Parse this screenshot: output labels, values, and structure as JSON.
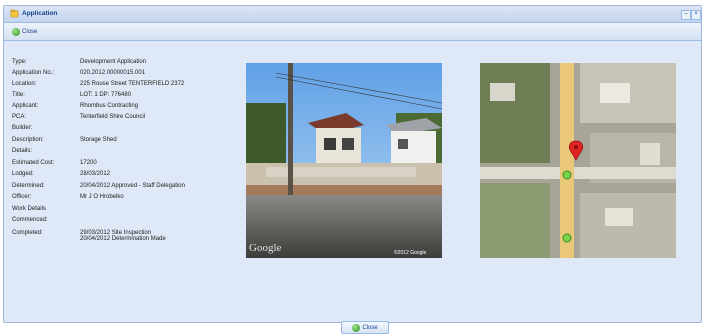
{
  "window": {
    "title": "Application"
  },
  "toolbar": {
    "close_label": "Close"
  },
  "details": [
    {
      "label": "Type:",
      "value": [
        "Development Application"
      ]
    },
    {
      "label": "Application No.:",
      "value": [
        "020.2012.00000015.001"
      ]
    },
    {
      "label": "Location:",
      "value": [
        "225 Rouse Street TENTERFIELD 2372"
      ]
    },
    {
      "label": "Title:",
      "value": [
        "LOT: 1 DP: 776480"
      ]
    },
    {
      "label": "Applicant:",
      "value": [
        "Rhombus Contracting"
      ]
    },
    {
      "label": "PCA:",
      "value": [
        "Tenterfield Shire Council"
      ]
    },
    {
      "label": "Builder:",
      "value": []
    },
    {
      "label": "Description:",
      "value": [
        "Storage Shed"
      ]
    },
    {
      "label": "Details:",
      "value": []
    },
    {
      "label": "Estimated Cost:",
      "value": [
        "17200"
      ]
    },
    {
      "label": "Lodged:",
      "value": [
        "28/03/2012"
      ]
    },
    {
      "label": "Determined:",
      "value": [
        "20/04/2012  Approved - Staff Delegation"
      ]
    },
    {
      "label": "Officer:",
      "value": [
        "Mr J O Hrobelko"
      ]
    },
    {
      "label": "Work Details",
      "value": []
    },
    {
      "label": "Commenced:",
      "value": []
    },
    {
      "label": "Completed:",
      "value": [
        "29/03/2012 Site Inspection",
        "20/04/2012 Determination Made"
      ]
    }
  ],
  "streetview": {
    "watermark": "Google",
    "copyright": "©2012 Google"
  },
  "footer": {
    "close_label": "Close"
  },
  "colors": {
    "header": "#15428b",
    "panel": "#dfe8f6",
    "border": "#99bbe8"
  }
}
